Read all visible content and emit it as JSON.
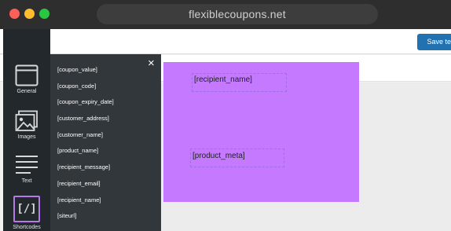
{
  "browser": {
    "url": "flexiblecoupons.net"
  },
  "toolbar": {
    "save_label": "Save temp"
  },
  "sidebar": {
    "items": [
      {
        "label": "General",
        "icon": "window-icon"
      },
      {
        "label": "Images",
        "icon": "image-icon"
      },
      {
        "label": "Text",
        "icon": "text-lines-icon"
      },
      {
        "label": "Shortcodes",
        "icon": "shortcode-icon",
        "symbol": "[/]"
      }
    ]
  },
  "panel": {
    "close_symbol": "×",
    "shortcodes": [
      "[coupon_value]",
      "[coupon_code]",
      "[coupon_expiry_date]",
      "[customer_address]",
      "[customer_name]",
      "[product_name]",
      "[recipient_message]",
      "[recipient_email]",
      "[recipient_name]",
      "[siteurl]"
    ]
  },
  "coupon": {
    "background_color": "#c479ff",
    "fields": [
      {
        "text": "[recipient_name]"
      },
      {
        "text": "[product_meta]"
      }
    ]
  }
}
